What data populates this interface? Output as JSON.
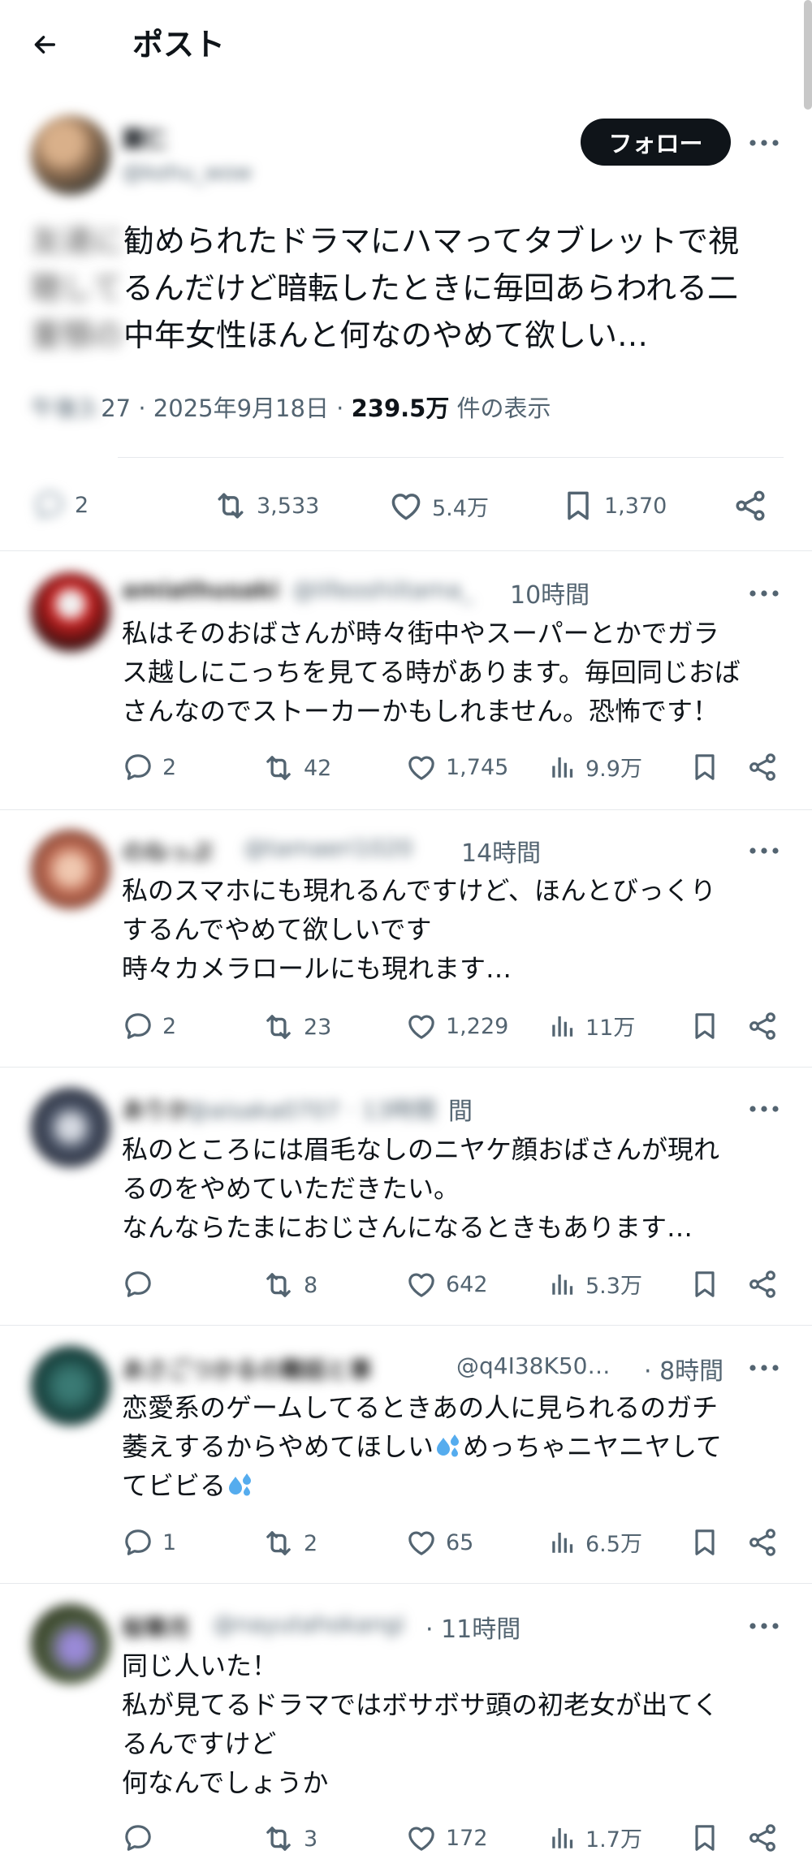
{
  "header": {
    "title": "ポスト"
  },
  "main_post": {
    "display_name": "麗仁",
    "handle": "@kohu_wow",
    "follow_label": "フォロー",
    "text_lines": [
      {
        "obscured": "友達に",
        "text": "勧められたドラマにハマってタブレットで視"
      },
      {
        "obscured": "聴して",
        "text": "るんだけど暗転したときに毎回あらわれる二"
      },
      {
        "obscured": "重顎の",
        "text": "中年女性ほんと何なのやめて欲しい…"
      }
    ],
    "meta_obscured": "午後3:",
    "meta_time_tail": "27",
    "meta_date": " · 2025年9月18日 · ",
    "meta_views": "239.5万",
    "meta_views_suffix": " 件の表示",
    "stats": {
      "replies": "2",
      "reposts": "3,533",
      "likes": "5.4万",
      "bookmarks": "1,370"
    }
  },
  "replies": [
    {
      "display_name": "amiathusaki",
      "handle": "@lifeoshiitama_",
      "time": "10時間",
      "lines": [
        "私はそのおばさんが時々街中やスーパーとかでガラ",
        "ス越しにこっちを見てる時があります。毎回同じおば",
        "さんなのでストーカーかもしれません。恐怖です！"
      ],
      "stats": {
        "replies": "2",
        "reposts": "42",
        "likes": "1,745",
        "views": "9.9万"
      }
    },
    {
      "display_name": "のねっぷ",
      "handle": "@tamaeri1020",
      "time": "14時間",
      "lines": [
        "私のスマホにも現れるんですけど、ほんとびっくり",
        "するんでやめて欲しいです",
        "時々カメラロールにも現れます…"
      ],
      "stats": {
        "replies": "2",
        "reposts": "23",
        "likes": "1,229",
        "views": "11万"
      }
    },
    {
      "display_name": "ありか",
      "handle": "@aisaka0707 · 13時間",
      "time_partial": "間",
      "lines": [
        "私のところには眉毛なしのニヤケ顔おばさんが現れ",
        "るのをやめていただきたい。",
        "なんならたまにおじさんになるときもあります…"
      ],
      "stats": {
        "replies": "",
        "reposts": "8",
        "likes": "642",
        "views": "5.3万"
      }
    },
    {
      "display_name": "あさごつかるの難話と事",
      "handle": "@q4I38K50…",
      "time": "· 8時間",
      "lines": [
        "恋愛系のゲームしてるときあの人に見られるのガチ",
        "萎えするからやめてほしい",
        "めっちゃニヤニヤして",
        "てビビる"
      ],
      "stats": {
        "replies": "1",
        "reposts": "2",
        "likes": "65",
        "views": "6.5万"
      }
    },
    {
      "display_name": "桜華月",
      "handle": "@nayutahokangi",
      "time": "· 11時間",
      "lines": [
        "同じ人いた！",
        "私が見てるドラマではボサボサ頭の初老女が出てく",
        "るんですけど",
        "何なんでしょうか"
      ],
      "stats": {
        "replies": "",
        "reposts": "3",
        "likes": "172",
        "views": "1.7万"
      }
    }
  ],
  "icons": {
    "back": "arrow-left-icon",
    "more": "more-dots-icon",
    "reply": "reply-bubble-icon",
    "repost": "repost-icon",
    "like": "heart-icon",
    "views": "views-bar-icon",
    "bookmark": "bookmark-icon",
    "share": "share-icon",
    "emoji": "sweat-droplets-icon"
  },
  "colors": {
    "follow_bg": "#0f1419",
    "secondary": "#536471",
    "divider": "#e6e9ec"
  }
}
